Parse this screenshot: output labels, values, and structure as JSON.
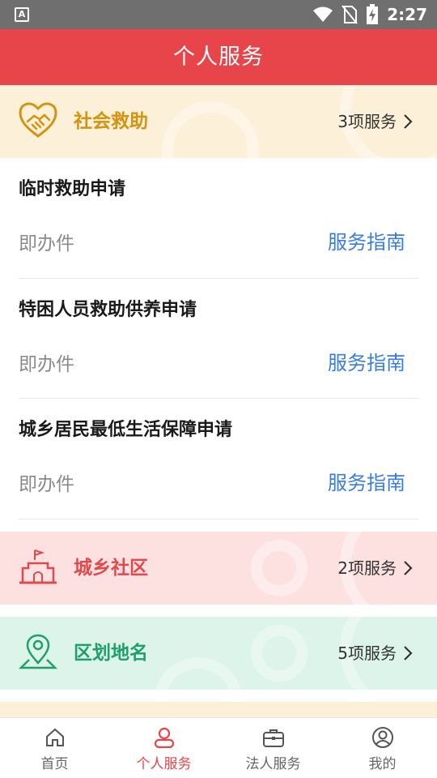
{
  "status_bar": {
    "time": "2:27",
    "left_icon": "A",
    "icons": [
      "wifi-icon",
      "no-sim-icon",
      "battery-charging-icon"
    ]
  },
  "header": {
    "title": "个人服务"
  },
  "categories": [
    {
      "title": "社会救助",
      "count": "3项服务",
      "icon": "handshake-heart-icon",
      "color": "#d4930f"
    },
    {
      "title": "城乡社区",
      "count": "2项服务",
      "icon": "building-flag-icon",
      "color": "#e04a4e"
    },
    {
      "title": "区划地名",
      "count": "5项服务",
      "icon": "map-pin-icon",
      "color": "#1ea06b"
    }
  ],
  "services": [
    {
      "name": "临时救助申请",
      "type": "即办件",
      "guide": "服务指南"
    },
    {
      "name": "特困人员救助供养申请",
      "type": "即办件",
      "guide": "服务指南"
    },
    {
      "name": "城乡居民最低生活保障申请",
      "type": "即办件",
      "guide": "服务指南"
    }
  ],
  "tabs": [
    {
      "label": "首页",
      "icon": "home-icon",
      "active": false
    },
    {
      "label": "个人服务",
      "icon": "person-icon",
      "active": true
    },
    {
      "label": "法人服务",
      "icon": "briefcase-icon",
      "active": false
    },
    {
      "label": "我的",
      "icon": "user-circle-icon",
      "active": false
    }
  ],
  "colors": {
    "header": "#e8454a",
    "active_tab": "#e8454a",
    "link": "#3a7de0"
  }
}
